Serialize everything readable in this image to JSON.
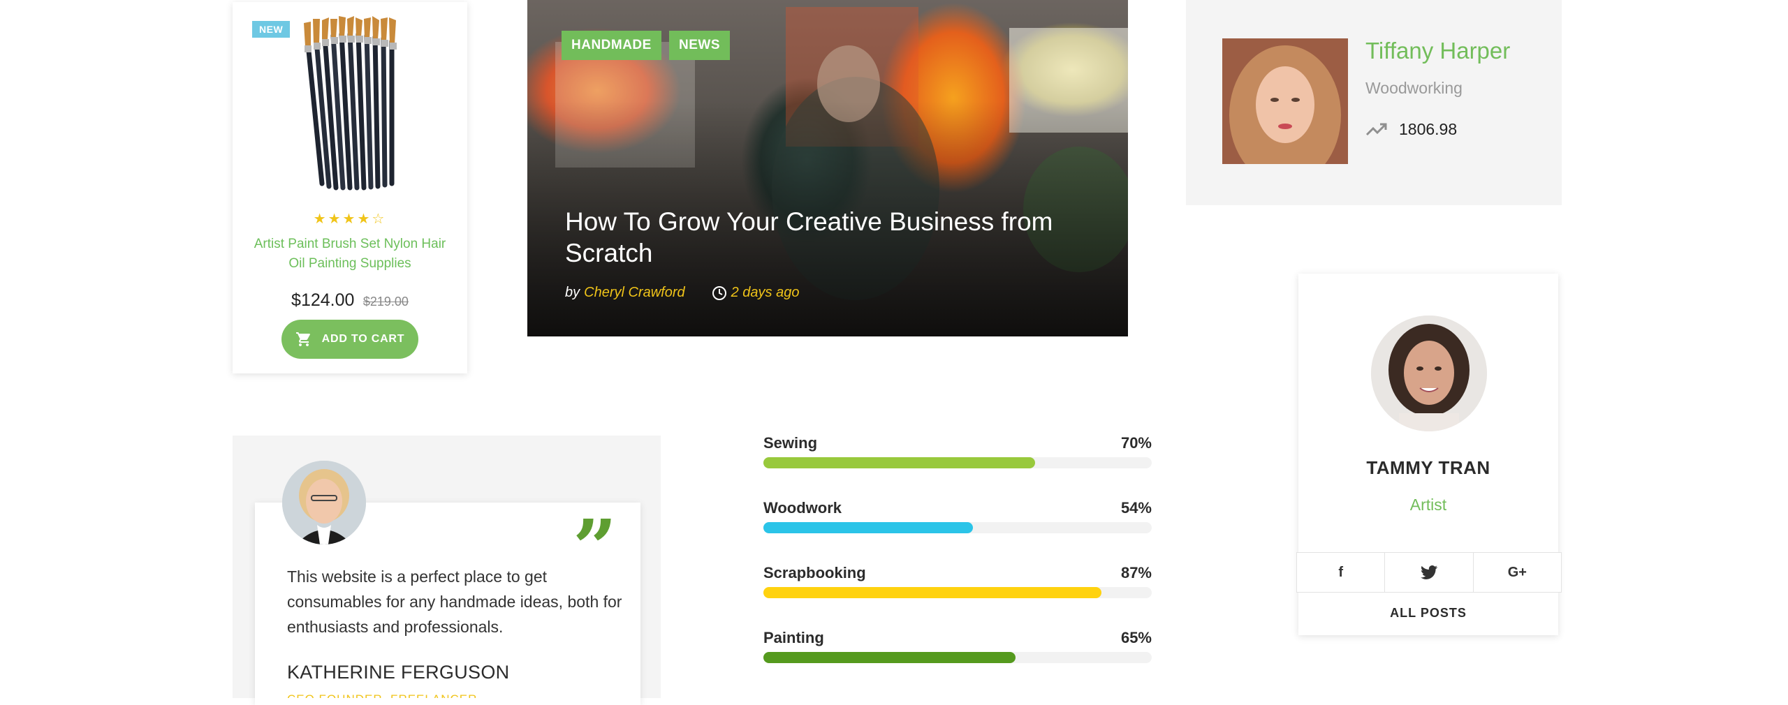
{
  "product": {
    "badge": "NEW",
    "rating": 3.5,
    "rating_max": 5,
    "stars_text": "★★★★☆",
    "title": "Artist Paint Brush Set Nylon Hair Oil Painting Supplies",
    "price": "$124.00",
    "old_price": "$219.00",
    "cart_label": "ADD TO CART",
    "icon": "cart-icon"
  },
  "hero": {
    "tags": [
      "HANDMADE",
      "NEWS"
    ],
    "title": "How To Grow Your Creative Business from Scratch",
    "by": "by",
    "author": "Cheryl Crawford",
    "time": "2 days ago",
    "time_icon": "clock-icon"
  },
  "author_box": {
    "name": "Tiffany Harper",
    "category": "Woodworking",
    "stat": "1806.98",
    "stat_icon": "trending-up-icon"
  },
  "team": {
    "name": "TAMMY TRAN",
    "role": "Artist",
    "social": [
      "f",
      "t",
      "G+"
    ],
    "all_posts": "ALL POSTS"
  },
  "testimonial": {
    "text": "This website is a perfect place to get consumables for any handmade ideas, both for enthusiasts and professionals.",
    "name": "KATHERINE FERGUSON",
    "subtitle": "CEO FOUNDER, FREELANCER"
  },
  "skills": [
    {
      "name": "Sewing",
      "percent": 70,
      "label": "70%",
      "color": "#98c93c"
    },
    {
      "name": "Woodwork",
      "percent": 54,
      "label": "54%",
      "color": "#2bc4e8"
    },
    {
      "name": "Scrapbooking",
      "percent": 87,
      "label": "87%",
      "color": "#ffd20f"
    },
    {
      "name": "Painting",
      "percent": 65,
      "label": "65%",
      "color": "#559a1e"
    }
  ]
}
